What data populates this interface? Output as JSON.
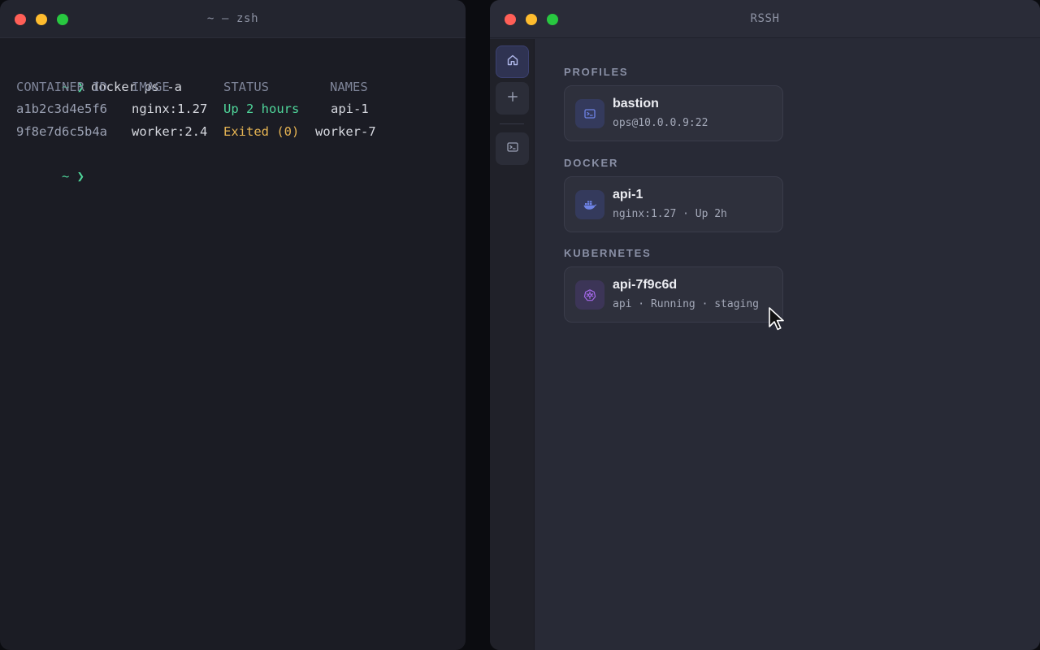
{
  "terminal": {
    "title": "~ — zsh",
    "prompt": "~ ❯",
    "command": "docker ps -a",
    "headers": [
      "CONTAINER ID",
      "IMAGE",
      "STATUS",
      "NAMES"
    ],
    "rows": [
      {
        "id": "a1b2c3d4e5f6",
        "image": "nginx:1.27",
        "status": "Up 2 hours",
        "name": "api-1"
      },
      {
        "id": "9f8e7d6c5b4a",
        "image": "worker:2.4",
        "status": "Exited (0)",
        "name": "worker-7"
      }
    ],
    "colors": {
      "prompt": "#4fd59a",
      "status_up": "#4fd59a",
      "status_exited": "#e6b453"
    }
  },
  "rssh": {
    "title": "RSSH",
    "sidebar": [
      {
        "icon": "home-icon",
        "active": true
      },
      {
        "icon": "plus-icon",
        "active": false
      },
      {
        "icon": "terminal-icon",
        "active": false
      }
    ],
    "sections": [
      {
        "label": "PROFILES",
        "card": {
          "icon": "terminal-icon",
          "title": "bastion",
          "subtitle": "ops@10.0.0.9:22"
        }
      },
      {
        "label": "DOCKER",
        "card": {
          "icon": "docker-icon",
          "title": "api-1",
          "subtitle": "nginx:1.27 · Up 2h"
        }
      },
      {
        "label": "KUBERNETES",
        "card": {
          "icon": "kubernetes-icon",
          "title": "api-7f9c6d",
          "subtitle": "api · Running · staging"
        }
      }
    ],
    "colors": {
      "accent": "#6e83e6",
      "kubernetes": "#a368e8"
    }
  }
}
